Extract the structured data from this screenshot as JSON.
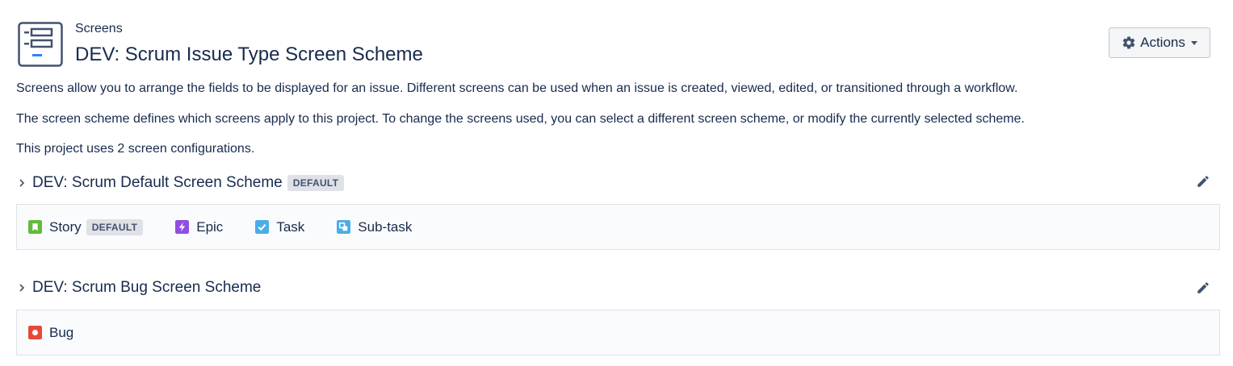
{
  "header": {
    "breadcrumb": "Screens",
    "title": "DEV: Scrum Issue Type Screen Scheme",
    "actions_label": "Actions"
  },
  "descriptions": [
    "Screens allow you to arrange the fields to be displayed for an issue. Different screens can be used when an issue is created, viewed, edited, or transitioned through a workflow.",
    "The screen scheme defines which screens apply to this project. To change the screens used, you can select a different screen scheme, or modify the currently selected scheme.",
    "This project uses 2 screen configurations."
  ],
  "schemes": [
    {
      "title": "DEV: Scrum Default Screen Scheme",
      "badge": "DEFAULT",
      "issue_types": [
        {
          "name": "Story",
          "badge": "DEFAULT",
          "icon": "story-icon",
          "color": "#63ba3c"
        },
        {
          "name": "Epic",
          "icon": "epic-icon",
          "color": "#904ee2"
        },
        {
          "name": "Task",
          "icon": "task-icon",
          "color": "#4bade8"
        },
        {
          "name": "Sub-task",
          "icon": "subtask-icon",
          "color": "#4bade8"
        }
      ]
    },
    {
      "title": "DEV: Scrum Bug Screen Scheme",
      "issue_types": [
        {
          "name": "Bug",
          "icon": "bug-icon",
          "color": "#e5493a"
        }
      ]
    }
  ]
}
